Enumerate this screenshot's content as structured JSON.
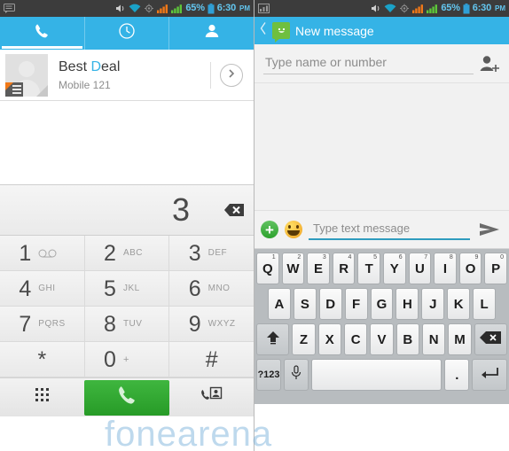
{
  "status_bar": {
    "left_icon_left_pane": "message-notification-icon",
    "left_icon_right_pane": "signal-chart-icon",
    "icons": [
      "volume-icon",
      "wifi-icon",
      "sync-icon",
      "signal-sim1-icon",
      "signal-sim2-icon"
    ],
    "battery_percent": "65%",
    "battery_icon": "battery-icon",
    "time": "6:30",
    "ampm": "PM",
    "bg_color": "#3c3c3c",
    "text_color": "#63c6ef"
  },
  "dialer": {
    "accent_color": "#35b3e6",
    "tabs": [
      {
        "name": "phone",
        "icon": "phone-icon",
        "active": true
      },
      {
        "name": "recents",
        "icon": "clock-icon",
        "active": false
      },
      {
        "name": "contacts",
        "icon": "person-icon",
        "active": false
      }
    ],
    "contact": {
      "name_prefix": "Best ",
      "name_highlight": "D",
      "name_suffix": "eal",
      "name_full": "Best Deal",
      "subtitle": "Mobile 121",
      "avatar_icon": "contact-avatar-placeholder",
      "sim_badge_icon": "sim-card-icon",
      "expand_icon": "chevron-right-icon"
    },
    "display": {
      "entered_number": "3",
      "backspace_icon": "backspace-icon"
    },
    "keys": [
      {
        "digit": "1",
        "letters": "",
        "icon": "voicemail-icon"
      },
      {
        "digit": "2",
        "letters": "ABC",
        "icon": ""
      },
      {
        "digit": "3",
        "letters": "DEF",
        "icon": ""
      },
      {
        "digit": "4",
        "letters": "GHI",
        "icon": ""
      },
      {
        "digit": "5",
        "letters": "JKL",
        "icon": ""
      },
      {
        "digit": "6",
        "letters": "MNO",
        "icon": ""
      },
      {
        "digit": "7",
        "letters": "PQRS",
        "icon": ""
      },
      {
        "digit": "8",
        "letters": "TUV",
        "icon": ""
      },
      {
        "digit": "9",
        "letters": "WXYZ",
        "icon": ""
      },
      {
        "digit": "*",
        "letters": "",
        "icon": ""
      },
      {
        "digit": "0",
        "letters": "+",
        "icon": ""
      },
      {
        "digit": "#",
        "letters": "",
        "icon": ""
      }
    ],
    "actions": {
      "keypad_toggle_icon": "dialpad-icon",
      "call_icon": "phone-call-icon",
      "call_button_color": "#2fa52f",
      "add_contact_icon": "add-contact-icon"
    }
  },
  "messaging": {
    "accent_color": "#35b3e6",
    "header": {
      "back_icon": "back-chevron-icon",
      "app_icon": "sms-app-icon",
      "title": "New message"
    },
    "recipient": {
      "value": "",
      "placeholder": "Type name or number",
      "add_contact_icon": "add-recipient-icon"
    },
    "compose": {
      "attach_icon": "plus-icon",
      "emoji_icon": "emoji-smiley-icon",
      "value": "",
      "placeholder": "Type text message",
      "send_icon": "send-arrow-icon",
      "underline_color": "#2f9cbf"
    },
    "keyboard": {
      "row1": [
        {
          "label": "Q",
          "sup": "1"
        },
        {
          "label": "W",
          "sup": "2"
        },
        {
          "label": "E",
          "sup": "3"
        },
        {
          "label": "R",
          "sup": "4"
        },
        {
          "label": "T",
          "sup": "5"
        },
        {
          "label": "Y",
          "sup": "6"
        },
        {
          "label": "U",
          "sup": "7"
        },
        {
          "label": "I",
          "sup": "8"
        },
        {
          "label": "O",
          "sup": "9"
        },
        {
          "label": "P",
          "sup": "0"
        }
      ],
      "row2": [
        {
          "label": "A"
        },
        {
          "label": "S"
        },
        {
          "label": "D"
        },
        {
          "label": "F"
        },
        {
          "label": "G"
        },
        {
          "label": "H"
        },
        {
          "label": "J"
        },
        {
          "label": "K"
        },
        {
          "label": "L"
        }
      ],
      "row3": [
        {
          "label": "",
          "icon": "shift-icon"
        },
        {
          "label": "Z"
        },
        {
          "label": "X"
        },
        {
          "label": "C"
        },
        {
          "label": "V"
        },
        {
          "label": "B"
        },
        {
          "label": "N"
        },
        {
          "label": "M"
        },
        {
          "label": "",
          "icon": "backspace-icon"
        }
      ],
      "row4": [
        {
          "label": "?123",
          "icon": ""
        },
        {
          "label": "",
          "icon": "microphone-icon"
        },
        {
          "label": "",
          "icon": "space-bar"
        },
        {
          "label": ".",
          "icon": ""
        },
        {
          "label": "",
          "icon": "enter-icon"
        }
      ]
    }
  },
  "watermark": {
    "text": "fonearena"
  }
}
